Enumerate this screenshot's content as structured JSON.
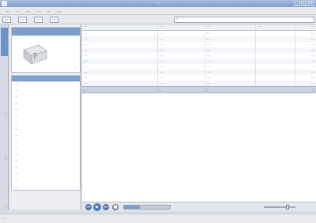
{
  "window": {
    "title": "…"
  },
  "menubar": {
    "items": [
      "…",
      "…",
      "…",
      "…",
      "…",
      "…"
    ]
  },
  "toolbar": {
    "buttons": [
      "…",
      "…",
      "…",
      "…"
    ],
    "search_placeholder": ""
  },
  "tabs": [
    "…",
    "…",
    "…",
    "…"
  ],
  "now_playing_card": {
    "title": "…",
    "subtitle": "…",
    "badge": "…"
  },
  "lyrics_panel": {
    "title": "…",
    "lines": [
      "…",
      "…",
      "…",
      "…",
      "…",
      "…",
      "…",
      "…",
      "…",
      "…",
      "…",
      "…",
      "…",
      "…",
      "…",
      "…",
      "…"
    ]
  },
  "playlist": {
    "columns": [
      "…",
      "…",
      "…",
      "…",
      "…"
    ],
    "rows": [
      [
        "…",
        "…",
        "…",
        "",
        "…"
      ],
      [
        "…",
        "…",
        "…",
        "",
        "…"
      ],
      [
        "…",
        "…",
        "…",
        "",
        "…"
      ],
      [
        "…",
        "…",
        "…",
        "",
        "…"
      ],
      [
        "…",
        "…",
        "…",
        "",
        "…"
      ],
      [
        "…",
        "…",
        "…",
        "",
        "…"
      ],
      [
        "…",
        "…",
        "…",
        "",
        "…"
      ],
      [
        "…",
        "…",
        "…",
        "",
        "…"
      ],
      [
        "…",
        "…",
        "…",
        "",
        "…"
      ],
      [
        "…",
        "…",
        "…",
        "",
        "…"
      ]
    ],
    "playing": [
      "…",
      "…",
      "…",
      "",
      "…"
    ]
  },
  "controls": {
    "prev_icon": "⏮",
    "play_icon": "▶",
    "next_icon": "⏭",
    "stop_icon": "■",
    "seek_fraction": 0.35,
    "volume_fraction": 0.75
  },
  "statusbar": {
    "text": "…"
  }
}
